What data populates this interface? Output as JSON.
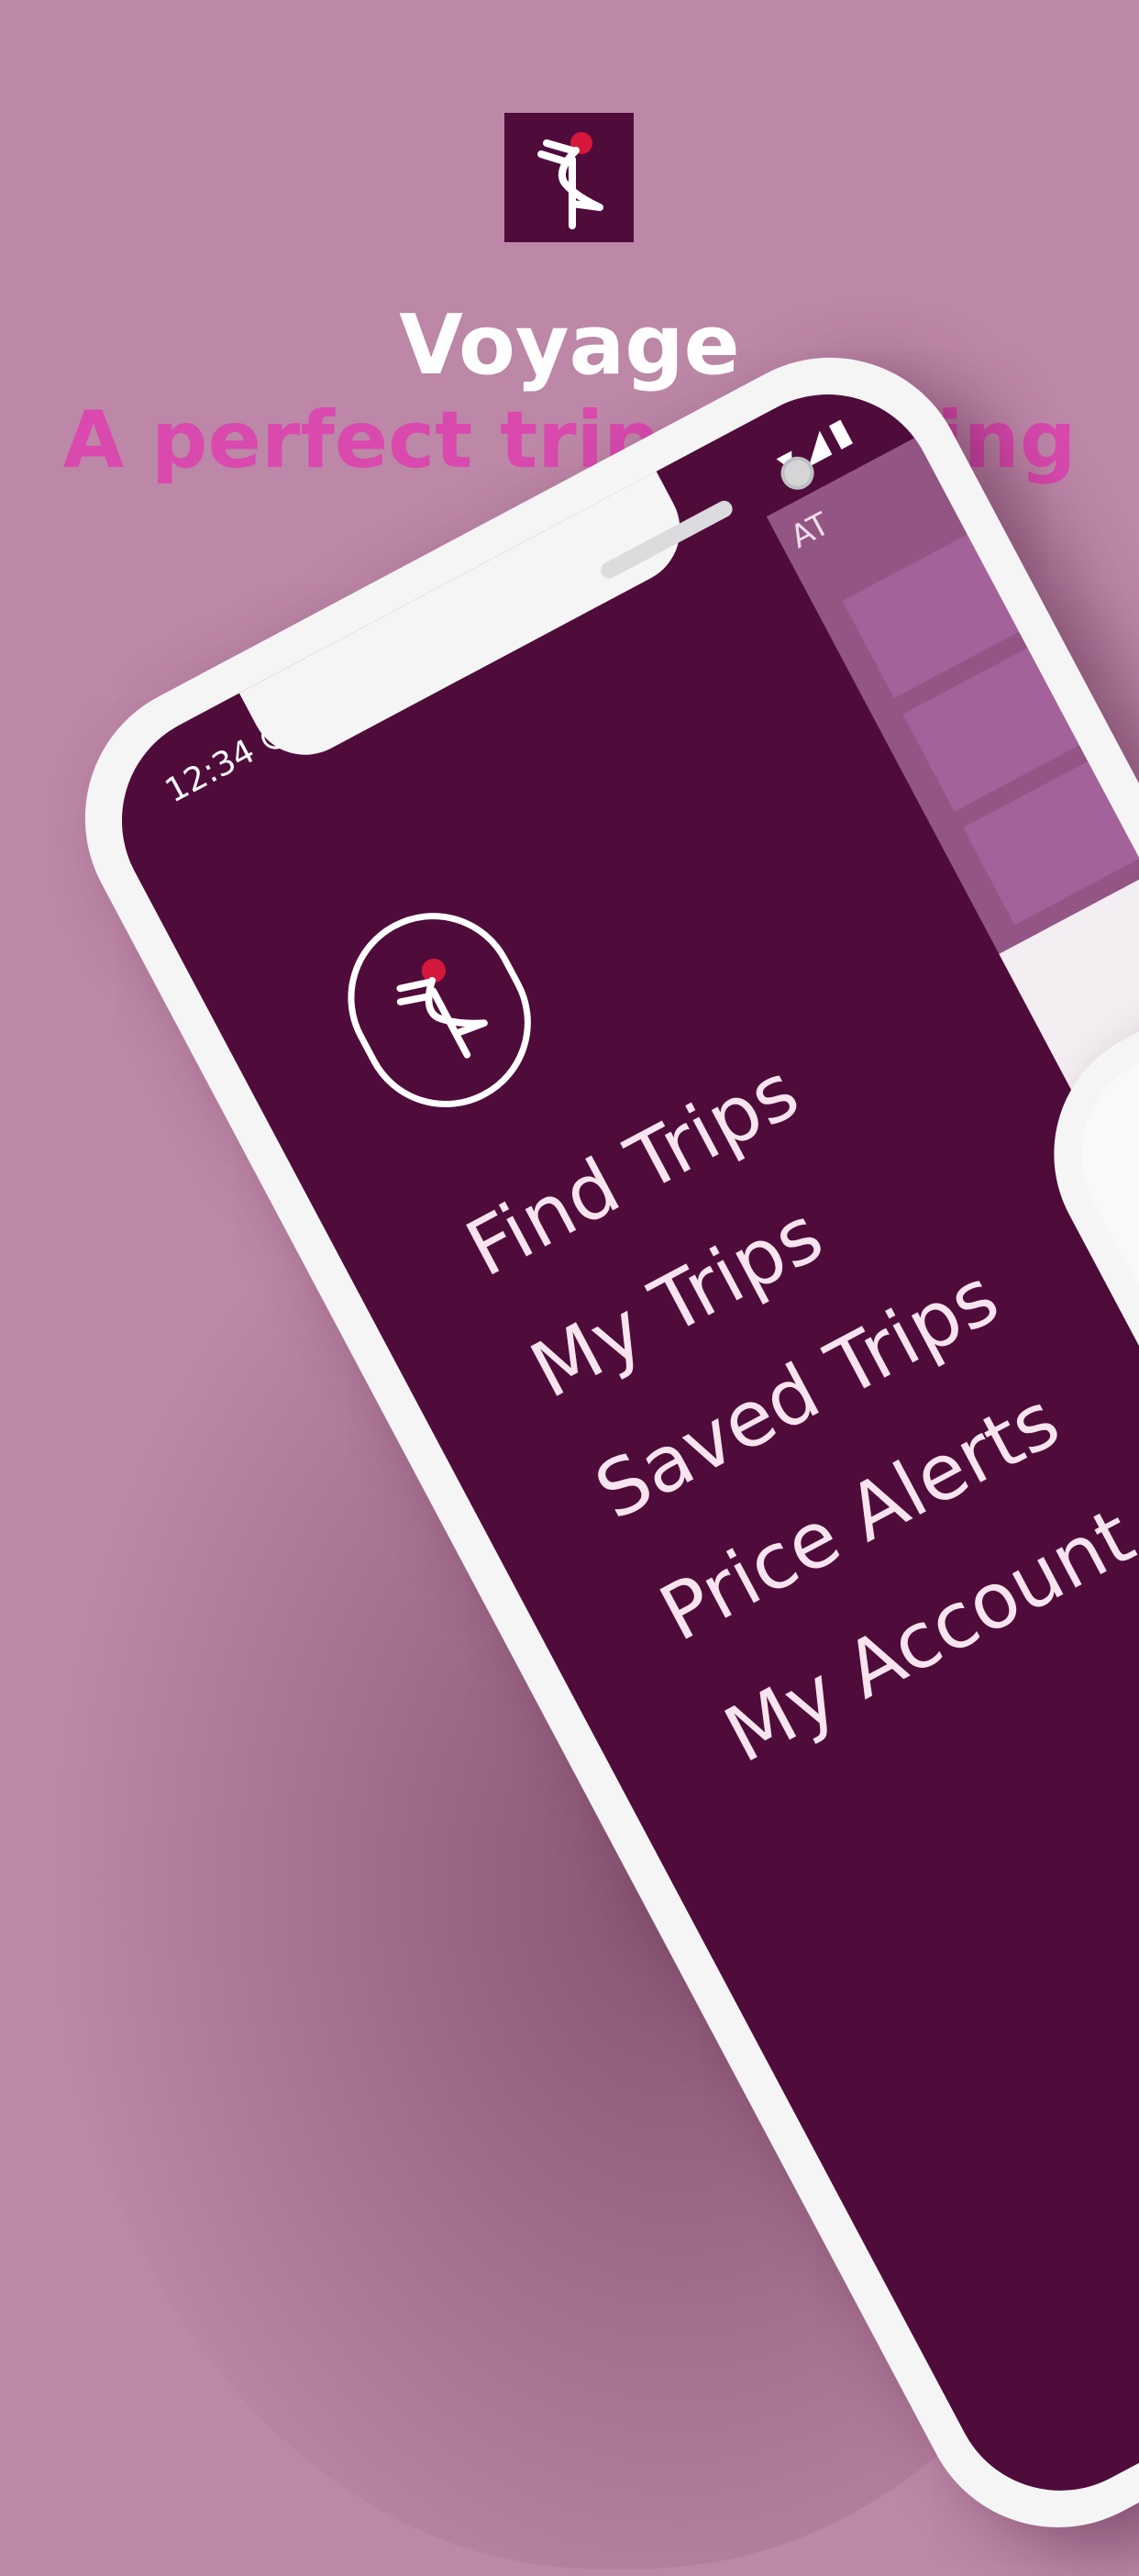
{
  "header": {
    "app_name": "Voyage",
    "tagline": "A perfect trip planning"
  },
  "colors": {
    "background": "#bd87a7",
    "brand_dark": "#4f0c3b",
    "accent_pink": "#d949ae",
    "logo_accent_red": "#d6173c",
    "menu_text": "#f7e4ee"
  },
  "phone": {
    "status_bar": {
      "time": "12:34",
      "icons": [
        "shield-icon",
        "globe-icon",
        "wifi-icon",
        "signal-icon",
        "battery-icon"
      ]
    },
    "drawer": {
      "logo_icon": "crane-bird-icon",
      "menu": [
        {
          "label": "Find Trips"
        },
        {
          "label": "My Trips"
        },
        {
          "label": "Saved Trips"
        },
        {
          "label": "Price Alerts"
        },
        {
          "label": "My Account"
        }
      ]
    },
    "background_screen": {
      "peek_label": "AT"
    }
  },
  "phone2": {
    "thumbnails": [
      "colosseum-photo",
      "alhambra-photo",
      "destination-photo"
    ]
  }
}
